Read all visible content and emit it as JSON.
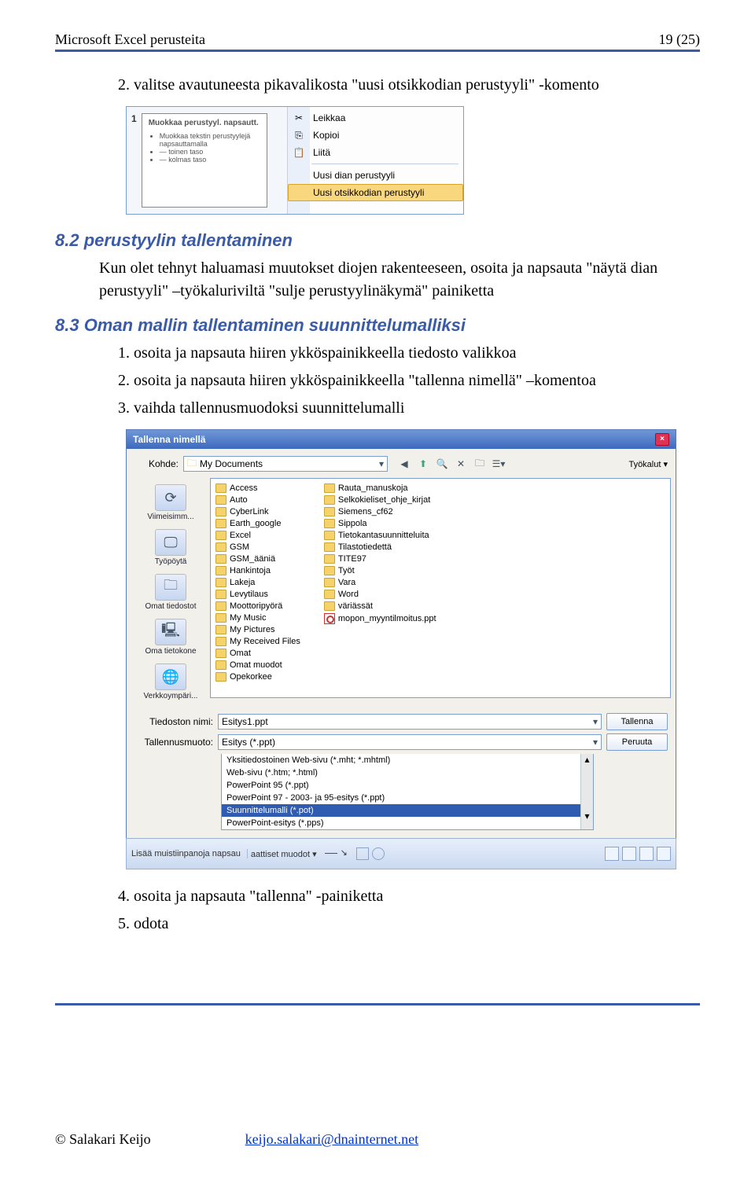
{
  "header": {
    "left": "Microsoft Excel perusteita",
    "right": "19 (25)"
  },
  "list1_start": 2,
  "list1": [
    "valitse avautuneesta pikavalikosta \"uusi otsikkodian perustyyli\" -komento"
  ],
  "contextmenu": {
    "slide_number": "1",
    "slide_title": "Muokkaa perustyyl. napsautt.",
    "slide_bullets": [
      "Muokkaa tekstin perustyylejä napsauttamalla",
      "— toinen taso",
      "— kolmas taso"
    ],
    "items": [
      {
        "icon": "✂",
        "label": "Leikkaa"
      },
      {
        "icon": "⎘",
        "label": "Kopioi"
      },
      {
        "icon": "📋",
        "label": "Liitä"
      },
      {
        "sep": true
      },
      {
        "icon": "",
        "label": "Uusi dian perustyyli"
      },
      {
        "icon": "",
        "label": "Uusi otsikkodian perustyyli",
        "selected": true
      }
    ]
  },
  "section82": {
    "title": "8.2 perustyylin tallentaminen",
    "text": "Kun olet tehnyt haluamasi muutokset diojen rakenteeseen, osoita ja napsauta \"näytä dian perustyyli\" –työkaluriviltä \"sulje perustyylinäkymä\" painiketta"
  },
  "section83": {
    "title": "8.3 Oman mallin tallentaminen suunnittelumalliksi"
  },
  "list2": [
    "osoita ja napsauta hiiren ykköspainikkeella tiedosto valikkoa",
    "osoita ja napsauta hiiren ykköspainikkeella \"tallenna nimellä\" –komentoa",
    "vaihda tallennusmuodoksi suunnittelumalli"
  ],
  "dialog": {
    "title": "Tallenna nimellä",
    "kohde_label": "Kohde:",
    "kohde_value": "My Documents",
    "tools_label": "Työkalut",
    "side": [
      {
        "icon": "⟳",
        "label": "Viimeisimm..."
      },
      {
        "icon": "🖵",
        "label": "Työpöytä"
      },
      {
        "icon": "🗀",
        "label": "Omat tiedostot"
      },
      {
        "icon": "🖳",
        "label": "Oma tietokone"
      },
      {
        "icon": "🌐",
        "label": "Verkkoympäri..."
      }
    ],
    "files_left": [
      "Access",
      "Auto",
      "CyberLink",
      "Earth_google",
      "Excel",
      "GSM",
      "GSM_ääniä",
      "Hankintoja",
      "Lakeja",
      "Levytilaus",
      "Moottoripyörä",
      "My Music",
      "My Pictures",
      "My Received Files",
      "Omat",
      "Omat muodot",
      "Opekorkee"
    ],
    "files_right": [
      "Rauta_manuskoja",
      "Selkokieliset_ohje_kirjat",
      "Siemens_cf62",
      "Sippola",
      "Tietokantasuunnitteluita",
      "Tilastotiedettä",
      "TITE97",
      "Työt",
      "Vara",
      "Word",
      "väriässät"
    ],
    "files_right_ppt": "mopon_myyntilmoitus.ppt",
    "filename_label": "Tiedoston nimi:",
    "filename_value": "Esitys1.ppt",
    "format_label": "Tallennusmuoto:",
    "format_value": "Esitys (*.ppt)",
    "btn_save": "Tallenna",
    "btn_cancel": "Peruuta",
    "dropdown": [
      "Yksitiedostoinen Web-sivu (*.mht; *.mhtml)",
      "Web-sivu (*.htm; *.html)",
      "PowerPoint 95 (*.ppt)",
      "PowerPoint 97 - 2003- ja 95-esitys (*.ppt)",
      "Suunnittelumalli (*.pot)",
      "PowerPoint-esitys (*.pps)"
    ],
    "dropdown_selected_index": 4,
    "bottom_left": "Lisää muistiinpanoja napsau",
    "bottom_label": "aattiset muodot ▾"
  },
  "list3_start": 4,
  "list3": [
    "osoita ja napsauta \"tallenna\" -painiketta",
    "odota"
  ],
  "footer": {
    "author": "© Salakari Keijo",
    "email": "keijo.salakari@dnainternet.net"
  }
}
